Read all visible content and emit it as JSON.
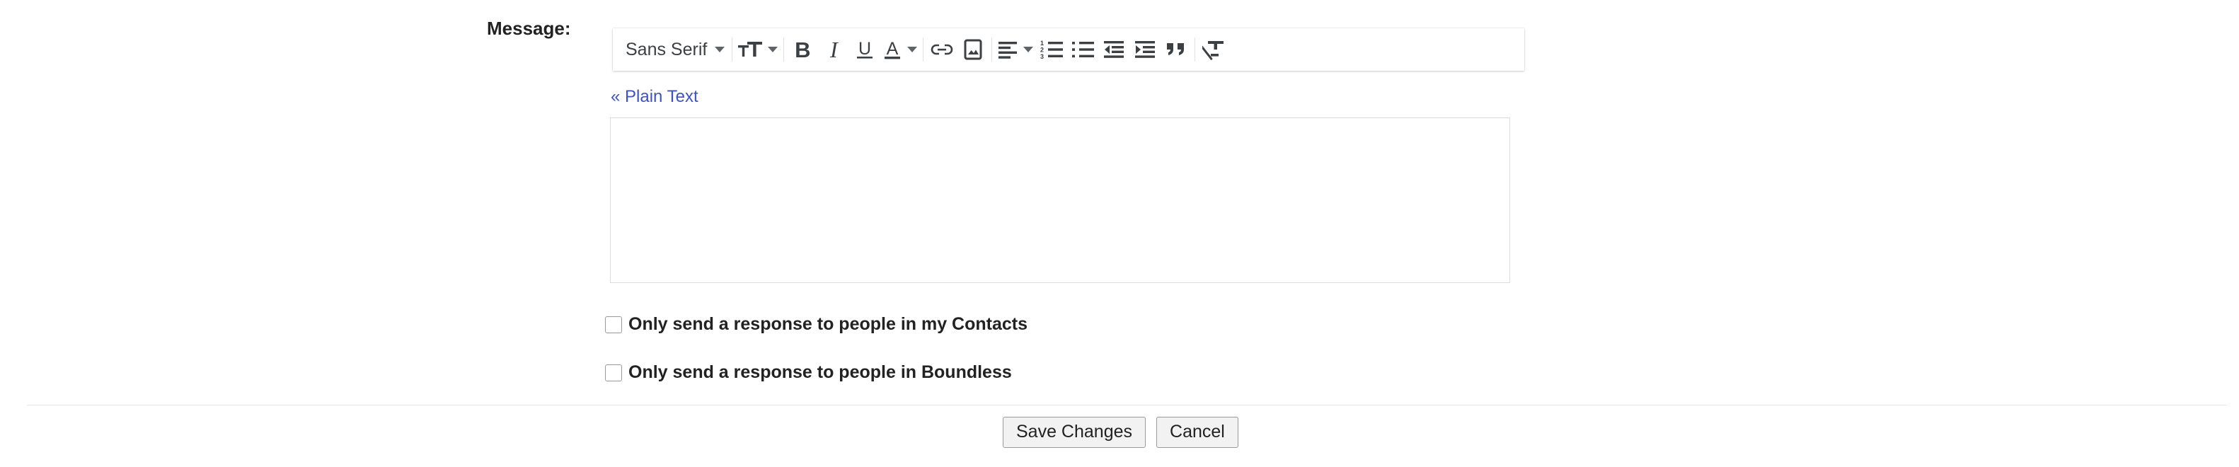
{
  "form": {
    "message_label": "Message:",
    "plain_text_link": "« Plain Text",
    "editor_value": "",
    "editor_placeholder": ""
  },
  "toolbar": {
    "font_family_value": "Sans Serif",
    "items": [
      {
        "name": "font-family-select",
        "label": "Sans Serif",
        "icon": "chevron-down-icon"
      },
      {
        "name": "font-size-button",
        "label": "",
        "icon": "font-size-icon"
      },
      {
        "name": "bold-button",
        "label": "B",
        "icon": "bold-icon"
      },
      {
        "name": "italic-button",
        "label": "I",
        "icon": "italic-icon"
      },
      {
        "name": "underline-button",
        "label": "U",
        "icon": "underline-icon"
      },
      {
        "name": "text-color-button",
        "label": "A",
        "icon": "text-color-icon"
      },
      {
        "name": "insert-link-button",
        "label": "",
        "icon": "link-icon"
      },
      {
        "name": "insert-image-button",
        "label": "",
        "icon": "image-icon"
      },
      {
        "name": "align-button",
        "label": "",
        "icon": "align-left-icon"
      },
      {
        "name": "numbered-list-button",
        "label": "",
        "icon": "numbered-list-icon"
      },
      {
        "name": "bulleted-list-button",
        "label": "",
        "icon": "bulleted-list-icon"
      },
      {
        "name": "indent-less-button",
        "label": "",
        "icon": "indent-less-icon"
      },
      {
        "name": "indent-more-button",
        "label": "",
        "icon": "indent-more-icon"
      },
      {
        "name": "quote-button",
        "label": "",
        "icon": "quote-icon"
      },
      {
        "name": "remove-formatting-button",
        "label": "",
        "icon": "remove-formatting-icon"
      }
    ]
  },
  "options": {
    "contacts_checkbox": {
      "label": "Only send a response to people in my Contacts",
      "checked": false
    },
    "boundless_checkbox": {
      "label": "Only send a response to people in Boundless",
      "checked": false
    }
  },
  "actions": {
    "save_label": "Save Changes",
    "cancel_label": "Cancel"
  },
  "colors": {
    "link": "#3f51c9",
    "text": "#222222",
    "icon": "#3c4043",
    "border": "#dadce0",
    "button_bg": "#f2f2f2",
    "divider": "#e6e6e6"
  }
}
